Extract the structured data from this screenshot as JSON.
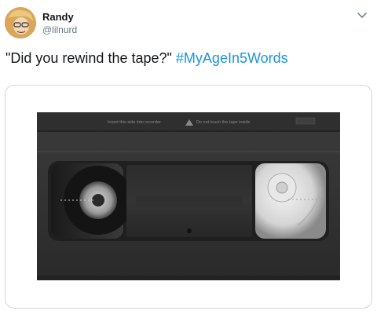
{
  "user": {
    "name": "Randy",
    "handle": "@lilnurd"
  },
  "tweet": {
    "text": "\"Did you rewind the tape?\"",
    "hashtag": "#MyAgeIn5Words"
  },
  "media": {
    "label_left": "Insert this side into recorder",
    "label_right": "Do not touch the tape inside"
  },
  "icons": {
    "menu": "chevron-down-icon",
    "warning": "warning-triangle-icon"
  },
  "colors": {
    "hashtag": "#1b95e0",
    "handle": "#657786",
    "border": "#ccd6dd"
  }
}
